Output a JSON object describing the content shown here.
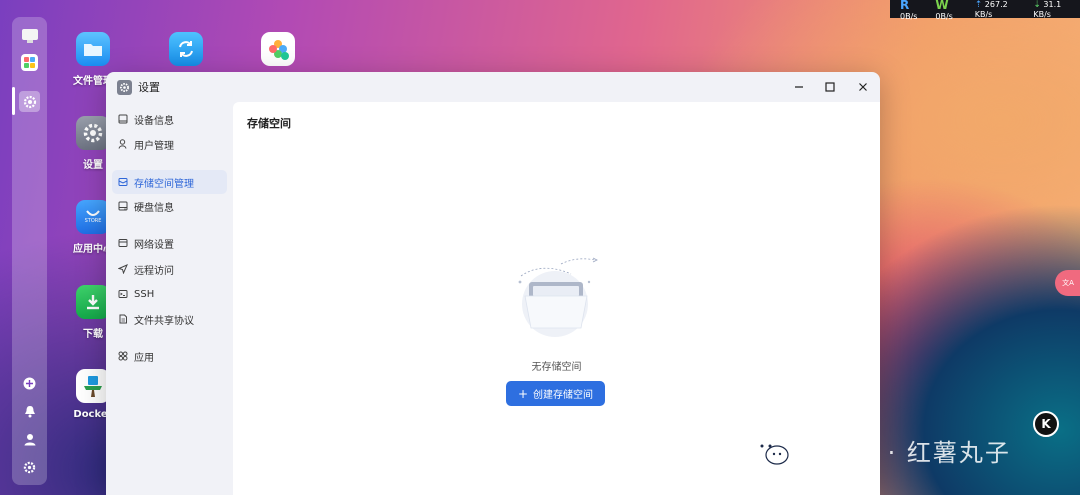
{
  "netbar": {
    "read_letter": "R",
    "read_rate": "0B/s",
    "write_letter": "W",
    "write_rate": "0B/s",
    "up_rate": "267.2 KB/s",
    "down_rate": "31.1 KB/s"
  },
  "desktop": {
    "icons": [
      {
        "label": "文件管理",
        "icon": "folder-icon"
      },
      {
        "label": "",
        "icon": "sync-icon"
      },
      {
        "label": "",
        "icon": "photos-icon"
      },
      {
        "label": "设置",
        "icon": "settings-icon"
      },
      {
        "label": "应用中心",
        "icon": "app-store-icon"
      },
      {
        "label": "下载",
        "icon": "download-icon"
      },
      {
        "label": "Docker",
        "icon": "docker-icon"
      }
    ],
    "store_badge": "STORE"
  },
  "window": {
    "title": "设置",
    "content_title": "存储空间",
    "empty_text": "无存储空间",
    "create_button": "创建存储空间",
    "create_button_icon": "+"
  },
  "sidebar": {
    "items": [
      {
        "label": "设备信息",
        "icon": "device-info-icon",
        "active": false
      },
      {
        "label": "用户管理",
        "icon": "user-icon",
        "active": false
      },
      {
        "label": "存储空间管理",
        "icon": "storage-icon",
        "active": true
      },
      {
        "label": "硬盘信息",
        "icon": "disk-icon",
        "active": false
      },
      {
        "label": "网络设置",
        "icon": "network-icon",
        "active": false
      },
      {
        "label": "远程访问",
        "icon": "remote-icon",
        "active": false
      },
      {
        "label": "SSH",
        "icon": "ssh-icon",
        "active": false
      },
      {
        "label": "文件共享协议",
        "icon": "file-share-icon",
        "active": false
      },
      {
        "label": "应用",
        "icon": "apps-icon",
        "active": false
      }
    ]
  },
  "widgets": {
    "lang_text": "文A",
    "k_logo": "K"
  },
  "watermark": {
    "text": "公众号 · 红薯丸子"
  },
  "colors": {
    "accent": "#2e6fe0",
    "active_bg": "#e4e9f6",
    "active_text": "#2e66d8"
  }
}
